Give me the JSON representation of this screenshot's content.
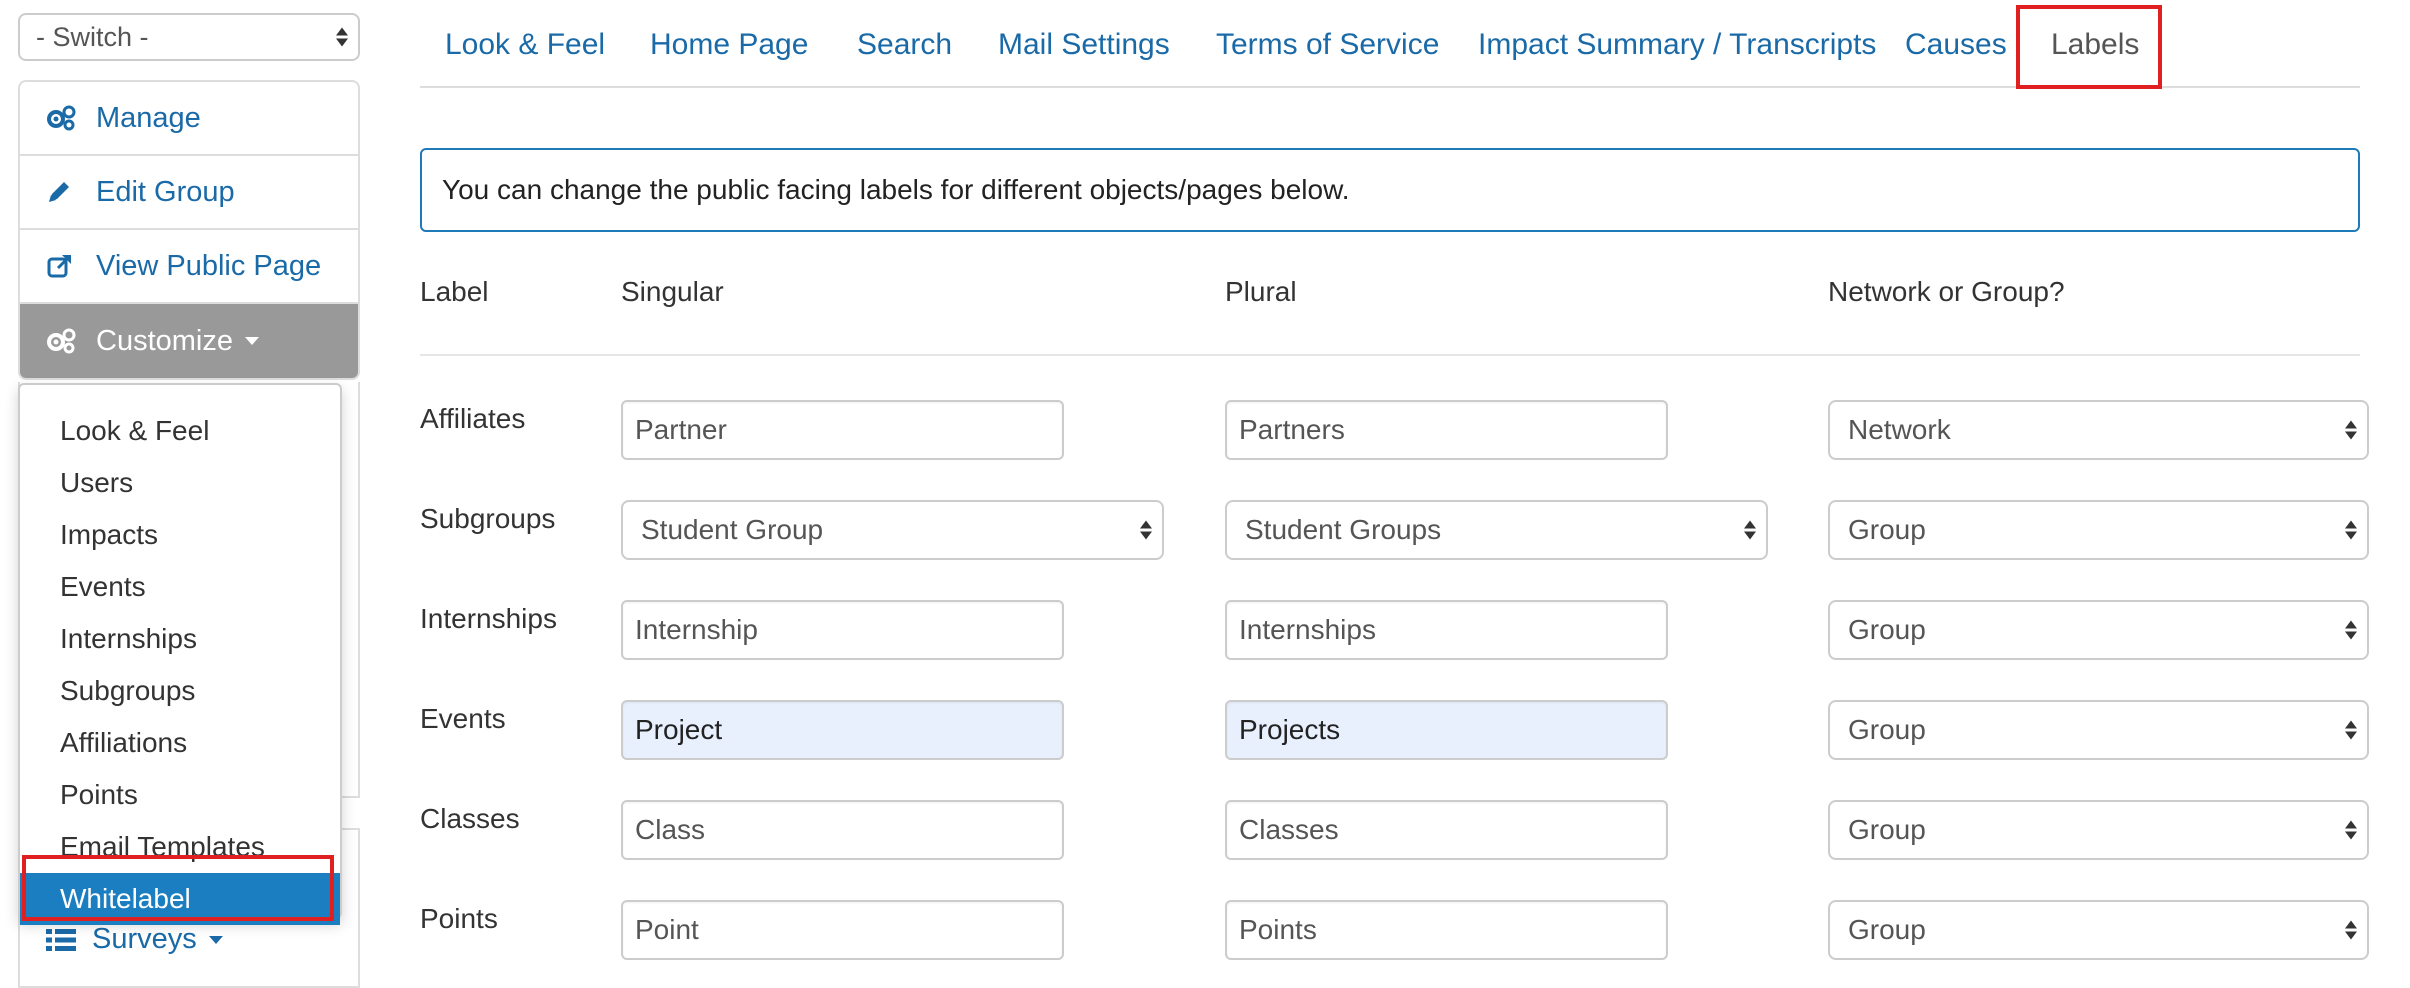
{
  "sidebar": {
    "switch_label": "- Switch -",
    "nav_items": [
      {
        "label": "Manage",
        "icon": "gears-icon"
      },
      {
        "label": "Edit Group",
        "icon": "pencil-icon"
      },
      {
        "label": "View Public Page",
        "icon": "external-link-icon"
      },
      {
        "label": "Customize",
        "icon": "gears-icon"
      }
    ],
    "dropdown_items": [
      "Look & Feel",
      "Users",
      "Impacts",
      "Events",
      "Internships",
      "Subgroups",
      "Affiliations",
      "Points",
      "Email Templates",
      "Whitelabel"
    ],
    "selected_item": "Whitelabel",
    "surveys_label": "Surveys"
  },
  "tabs": [
    "Look & Feel",
    "Home Page",
    "Search",
    "Mail Settings",
    "Terms of Service",
    "Impact Summary / Transcripts",
    "Causes",
    "Labels"
  ],
  "active_tab": "Labels",
  "info_text": "You can change the public facing labels for different objects/pages below.",
  "table": {
    "headers": {
      "label": "Label",
      "singular": "Singular",
      "plural": "Plural",
      "scope": "Network or Group?"
    },
    "rows": [
      {
        "label": "Affiliates",
        "singular": "Partner",
        "plural": "Partners",
        "scope": "Network"
      },
      {
        "label": "Subgroups",
        "singular": "Student Group",
        "plural": "Student Groups",
        "scope": "Group"
      },
      {
        "label": "Internships",
        "singular": "Internship",
        "plural": "Internships",
        "scope": "Group"
      },
      {
        "label": "Events",
        "singular": "Project",
        "plural": "Projects",
        "scope": "Group"
      },
      {
        "label": "Classes",
        "singular": "Class",
        "plural": "Classes",
        "scope": "Group"
      },
      {
        "label": "Points",
        "singular": "Point",
        "plural": "Points",
        "scope": "Group"
      }
    ]
  },
  "colors": {
    "link": "#1a6aa8",
    "highlight": "#e02020",
    "selected": "#1b7ec0",
    "info_border": "#1f7ab8",
    "autofill": "#e8f0fe"
  }
}
